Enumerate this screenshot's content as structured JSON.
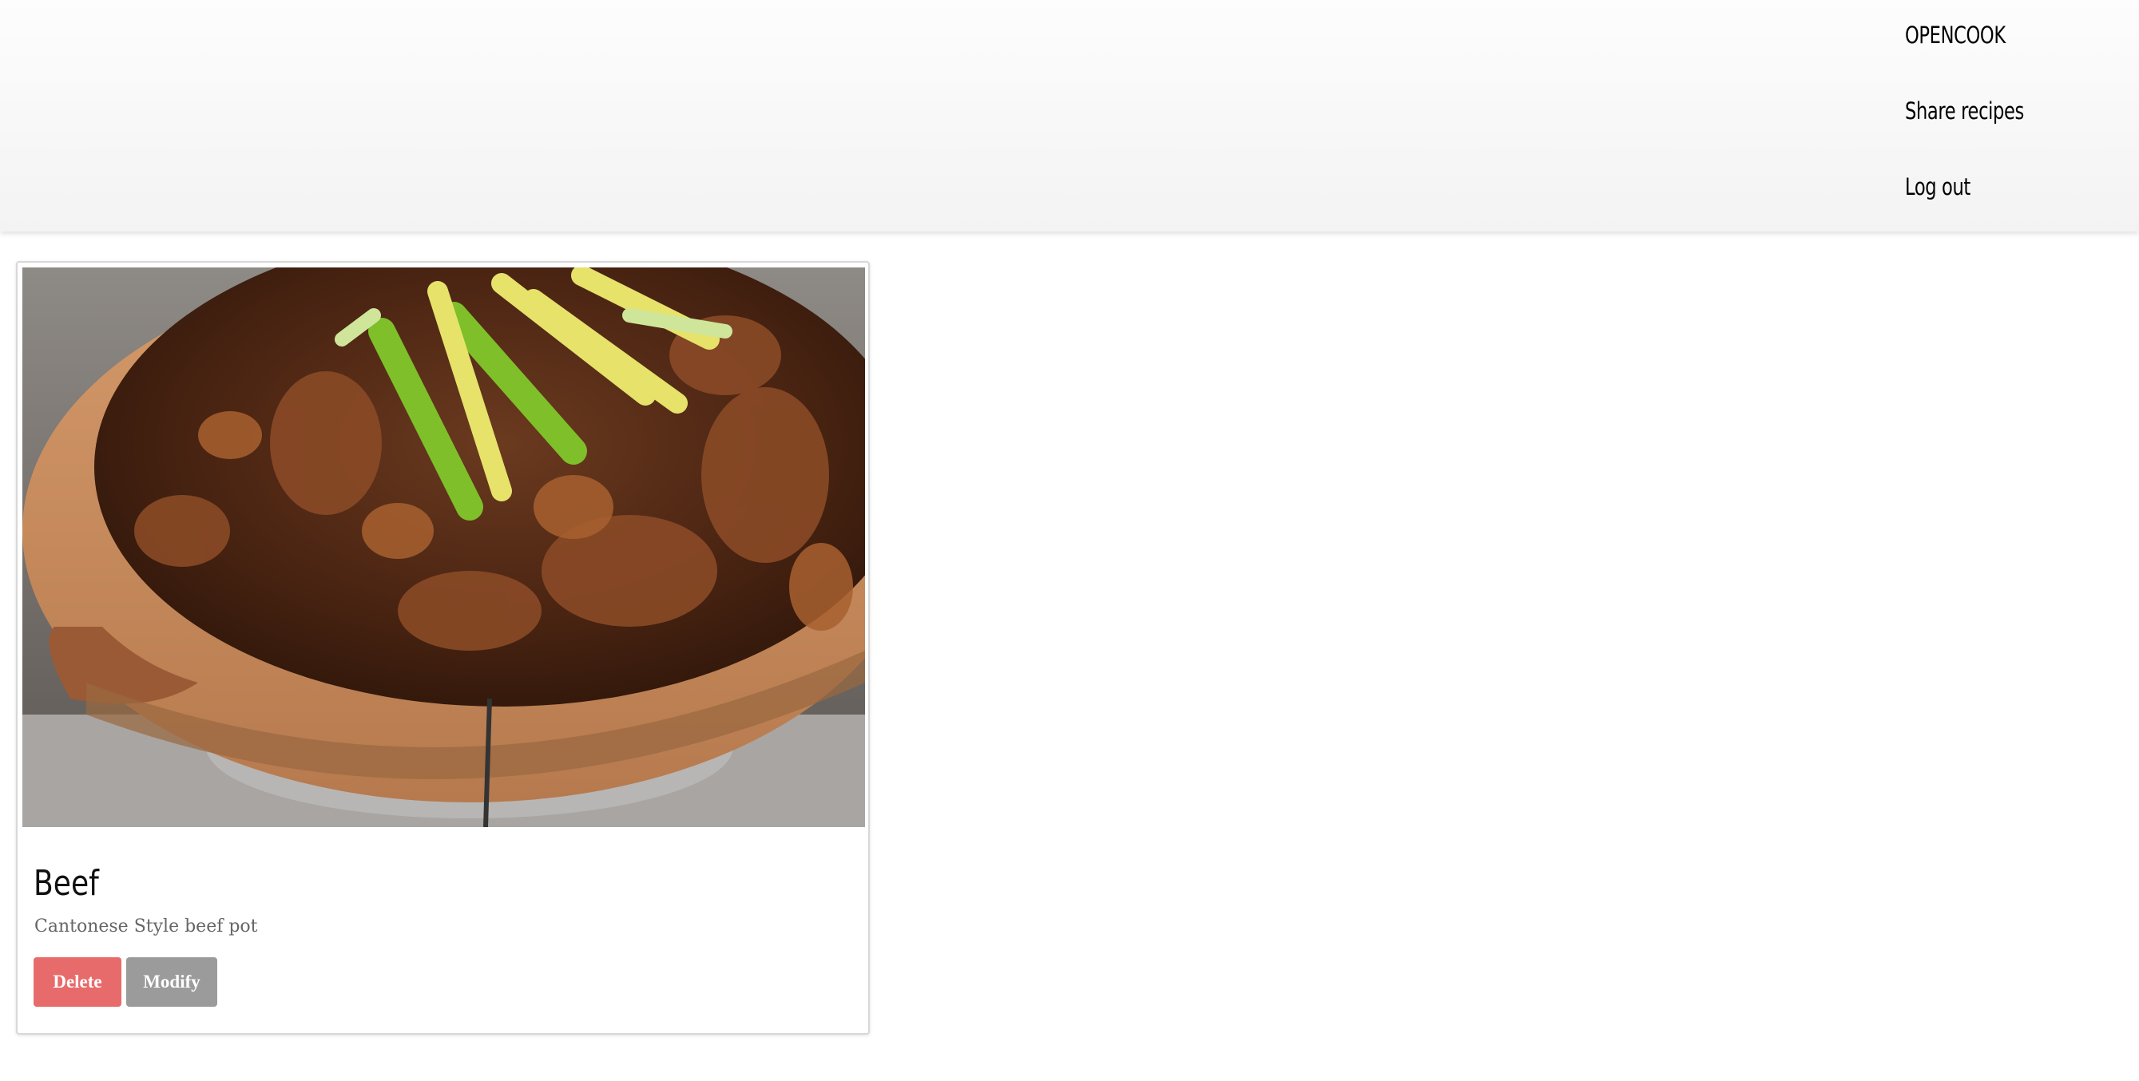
{
  "nav": {
    "brand": "OPENCOOK",
    "share_label": "Share recipes",
    "logout_label": "Log out"
  },
  "recipe": {
    "title": "Beef",
    "description": "Cantonese Style beef pot",
    "image_alt": "Cantonese style beef pot",
    "delete_label": "Delete",
    "modify_label": "Modify"
  }
}
